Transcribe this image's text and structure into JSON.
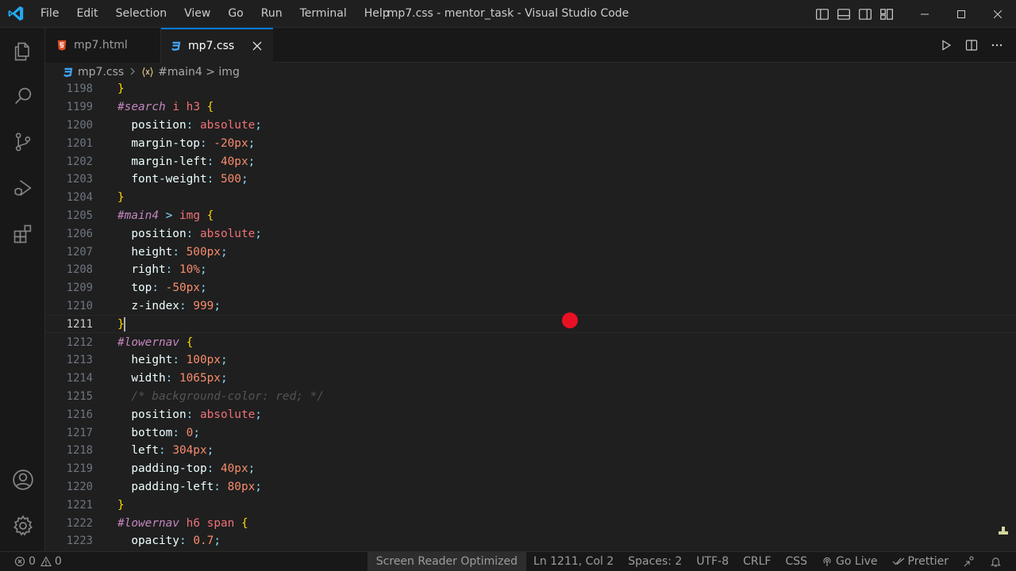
{
  "menu": [
    "File",
    "Edit",
    "Selection",
    "View",
    "Go",
    "Run",
    "Terminal",
    "Help"
  ],
  "window_title": "mp7.css - mentor_task - Visual Studio Code",
  "tabs": [
    {
      "label": "mp7.html",
      "icon": "html5-icon",
      "icon_color": "#e44d26",
      "active": false
    },
    {
      "label": "mp7.css",
      "icon": "css3-icon",
      "icon_color": "#42a5f5",
      "active": true
    }
  ],
  "breadcrumb": {
    "file": "mp7.css",
    "selector": "#main4 > img"
  },
  "code": [
    {
      "n": "1198",
      "tokens": [
        [
          "b",
          "}"
        ]
      ]
    },
    {
      "n": "1199",
      "tokens": [
        [
          "id",
          "#search"
        ],
        [
          "s",
          " "
        ],
        [
          "tag",
          "i"
        ],
        [
          "s",
          " "
        ],
        [
          "tag",
          "h3"
        ],
        [
          "s",
          " "
        ],
        [
          "b",
          "{"
        ]
      ]
    },
    {
      "n": "1200",
      "tokens": [
        [
          "s",
          "  "
        ],
        [
          "p",
          "position"
        ],
        [
          "pu",
          ": "
        ],
        [
          "v",
          "absolute"
        ],
        [
          "pu",
          ";"
        ]
      ]
    },
    {
      "n": "1201",
      "tokens": [
        [
          "s",
          "  "
        ],
        [
          "p",
          "margin-top"
        ],
        [
          "pu",
          ": "
        ],
        [
          "num",
          "-20px"
        ],
        [
          "pu",
          ";"
        ]
      ]
    },
    {
      "n": "1202",
      "tokens": [
        [
          "s",
          "  "
        ],
        [
          "p",
          "margin-left"
        ],
        [
          "pu",
          ": "
        ],
        [
          "num",
          "40px"
        ],
        [
          "pu",
          ";"
        ]
      ]
    },
    {
      "n": "1203",
      "tokens": [
        [
          "s",
          "  "
        ],
        [
          "p",
          "font-weight"
        ],
        [
          "pu",
          ": "
        ],
        [
          "num",
          "500"
        ],
        [
          "pu",
          ";"
        ]
      ]
    },
    {
      "n": "1204",
      "tokens": [
        [
          "b",
          "}"
        ]
      ]
    },
    {
      "n": "1205",
      "tokens": [
        [
          "id",
          "#main4"
        ],
        [
          "s",
          " "
        ],
        [
          "op",
          ">"
        ],
        [
          "s",
          " "
        ],
        [
          "tag",
          "img"
        ],
        [
          "s",
          " "
        ],
        [
          "b",
          "{"
        ]
      ]
    },
    {
      "n": "1206",
      "tokens": [
        [
          "s",
          "  "
        ],
        [
          "p",
          "position"
        ],
        [
          "pu",
          ": "
        ],
        [
          "v",
          "absolute"
        ],
        [
          "pu",
          ";"
        ]
      ]
    },
    {
      "n": "1207",
      "tokens": [
        [
          "s",
          "  "
        ],
        [
          "p",
          "height"
        ],
        [
          "pu",
          ": "
        ],
        [
          "num",
          "500px"
        ],
        [
          "pu",
          ";"
        ]
      ]
    },
    {
      "n": "1208",
      "tokens": [
        [
          "s",
          "  "
        ],
        [
          "p",
          "right"
        ],
        [
          "pu",
          ": "
        ],
        [
          "num",
          "10%"
        ],
        [
          "pu",
          ";"
        ]
      ]
    },
    {
      "n": "1209",
      "tokens": [
        [
          "s",
          "  "
        ],
        [
          "p",
          "top"
        ],
        [
          "pu",
          ": "
        ],
        [
          "num",
          "-50px"
        ],
        [
          "pu",
          ";"
        ]
      ]
    },
    {
      "n": "1210",
      "tokens": [
        [
          "s",
          "  "
        ],
        [
          "p",
          "z-index"
        ],
        [
          "pu",
          ": "
        ],
        [
          "num",
          "999"
        ],
        [
          "pu",
          ";"
        ]
      ]
    },
    {
      "n": "1211",
      "tokens": [
        [
          "b",
          "}"
        ],
        [
          "cursor",
          ""
        ]
      ],
      "current": true
    },
    {
      "n": "1212",
      "tokens": [
        [
          "id",
          "#lowernav"
        ],
        [
          "s",
          " "
        ],
        [
          "b",
          "{"
        ]
      ]
    },
    {
      "n": "1213",
      "tokens": [
        [
          "s",
          "  "
        ],
        [
          "p",
          "height"
        ],
        [
          "pu",
          ": "
        ],
        [
          "num",
          "100px"
        ],
        [
          "pu",
          ";"
        ]
      ]
    },
    {
      "n": "1214",
      "tokens": [
        [
          "s",
          "  "
        ],
        [
          "p",
          "width"
        ],
        [
          "pu",
          ": "
        ],
        [
          "num",
          "1065px"
        ],
        [
          "pu",
          ";"
        ]
      ]
    },
    {
      "n": "1215",
      "tokens": [
        [
          "s",
          "  "
        ],
        [
          "c",
          "/* background-color: red; */"
        ]
      ]
    },
    {
      "n": "1216",
      "tokens": [
        [
          "s",
          "  "
        ],
        [
          "p",
          "position"
        ],
        [
          "pu",
          ": "
        ],
        [
          "v",
          "absolute"
        ],
        [
          "pu",
          ";"
        ]
      ]
    },
    {
      "n": "1217",
      "tokens": [
        [
          "s",
          "  "
        ],
        [
          "p",
          "bottom"
        ],
        [
          "pu",
          ": "
        ],
        [
          "num",
          "0"
        ],
        [
          "pu",
          ";"
        ]
      ]
    },
    {
      "n": "1218",
      "tokens": [
        [
          "s",
          "  "
        ],
        [
          "p",
          "left"
        ],
        [
          "pu",
          ": "
        ],
        [
          "num",
          "304px"
        ],
        [
          "pu",
          ";"
        ]
      ]
    },
    {
      "n": "1219",
      "tokens": [
        [
          "s",
          "  "
        ],
        [
          "p",
          "padding-top"
        ],
        [
          "pu",
          ": "
        ],
        [
          "num",
          "40px"
        ],
        [
          "pu",
          ";"
        ]
      ]
    },
    {
      "n": "1220",
      "tokens": [
        [
          "s",
          "  "
        ],
        [
          "p",
          "padding-left"
        ],
        [
          "pu",
          ": "
        ],
        [
          "num",
          "80px"
        ],
        [
          "pu",
          ";"
        ]
      ]
    },
    {
      "n": "1221",
      "tokens": [
        [
          "b",
          "}"
        ]
      ]
    },
    {
      "n": "1222",
      "tokens": [
        [
          "id",
          "#lowernav"
        ],
        [
          "s",
          " "
        ],
        [
          "tag",
          "h6"
        ],
        [
          "s",
          " "
        ],
        [
          "tag",
          "span"
        ],
        [
          "s",
          " "
        ],
        [
          "b",
          "{"
        ]
      ]
    },
    {
      "n": "1223",
      "tokens": [
        [
          "s",
          "  "
        ],
        [
          "p",
          "opacity"
        ],
        [
          "pu",
          ": "
        ],
        [
          "num",
          "0.7"
        ],
        [
          "pu",
          ";"
        ]
      ]
    }
  ],
  "status": {
    "errors": "0",
    "warnings": "0",
    "screen_reader": "Screen Reader Optimized",
    "position": "Ln 1211, Col 2",
    "spaces": "Spaces: 2",
    "encoding": "UTF-8",
    "eol": "CRLF",
    "language": "CSS",
    "go_live": "Go Live",
    "prettier": "Prettier"
  },
  "colors": {
    "accent": "#0078d4",
    "vscode_logo": "#23a9f2",
    "mouse_indicator": "#e81123"
  }
}
